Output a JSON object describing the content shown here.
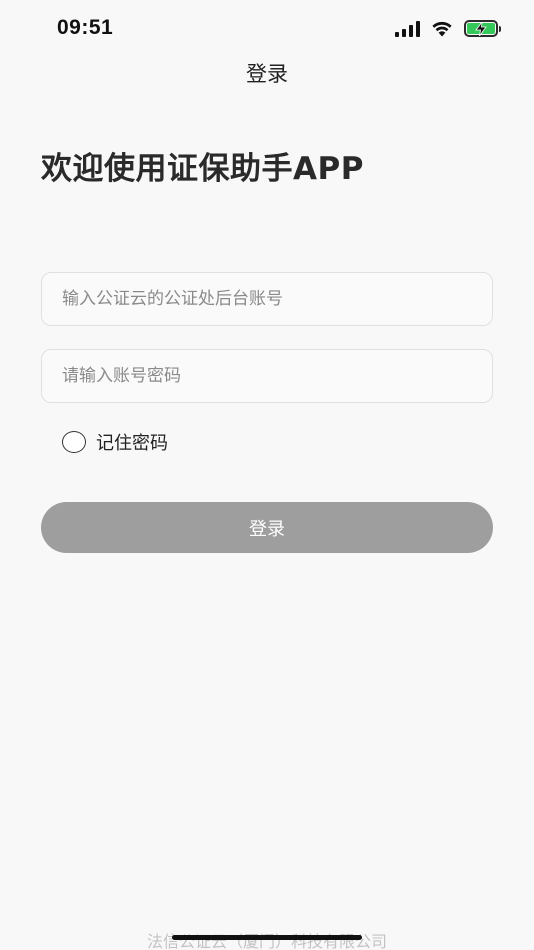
{
  "status_bar": {
    "time": "09:51",
    "icons": [
      "signal-icon",
      "wifi-icon",
      "battery-charging-icon"
    ],
    "battery_color": "#34c759"
  },
  "nav": {
    "title": "登录"
  },
  "welcome": {
    "title": "欢迎使用证保助手APP"
  },
  "form": {
    "account_placeholder": "输入公证云的公证处后台账号",
    "account_value": "",
    "password_placeholder": "请输入账号密码",
    "password_value": "",
    "remember_label": "记住密码",
    "remember_checked": false
  },
  "login_button": {
    "label": "登录",
    "color": "#9e9e9e"
  },
  "footer": {
    "text": "法信公证云（厦门）科技有限公司"
  }
}
